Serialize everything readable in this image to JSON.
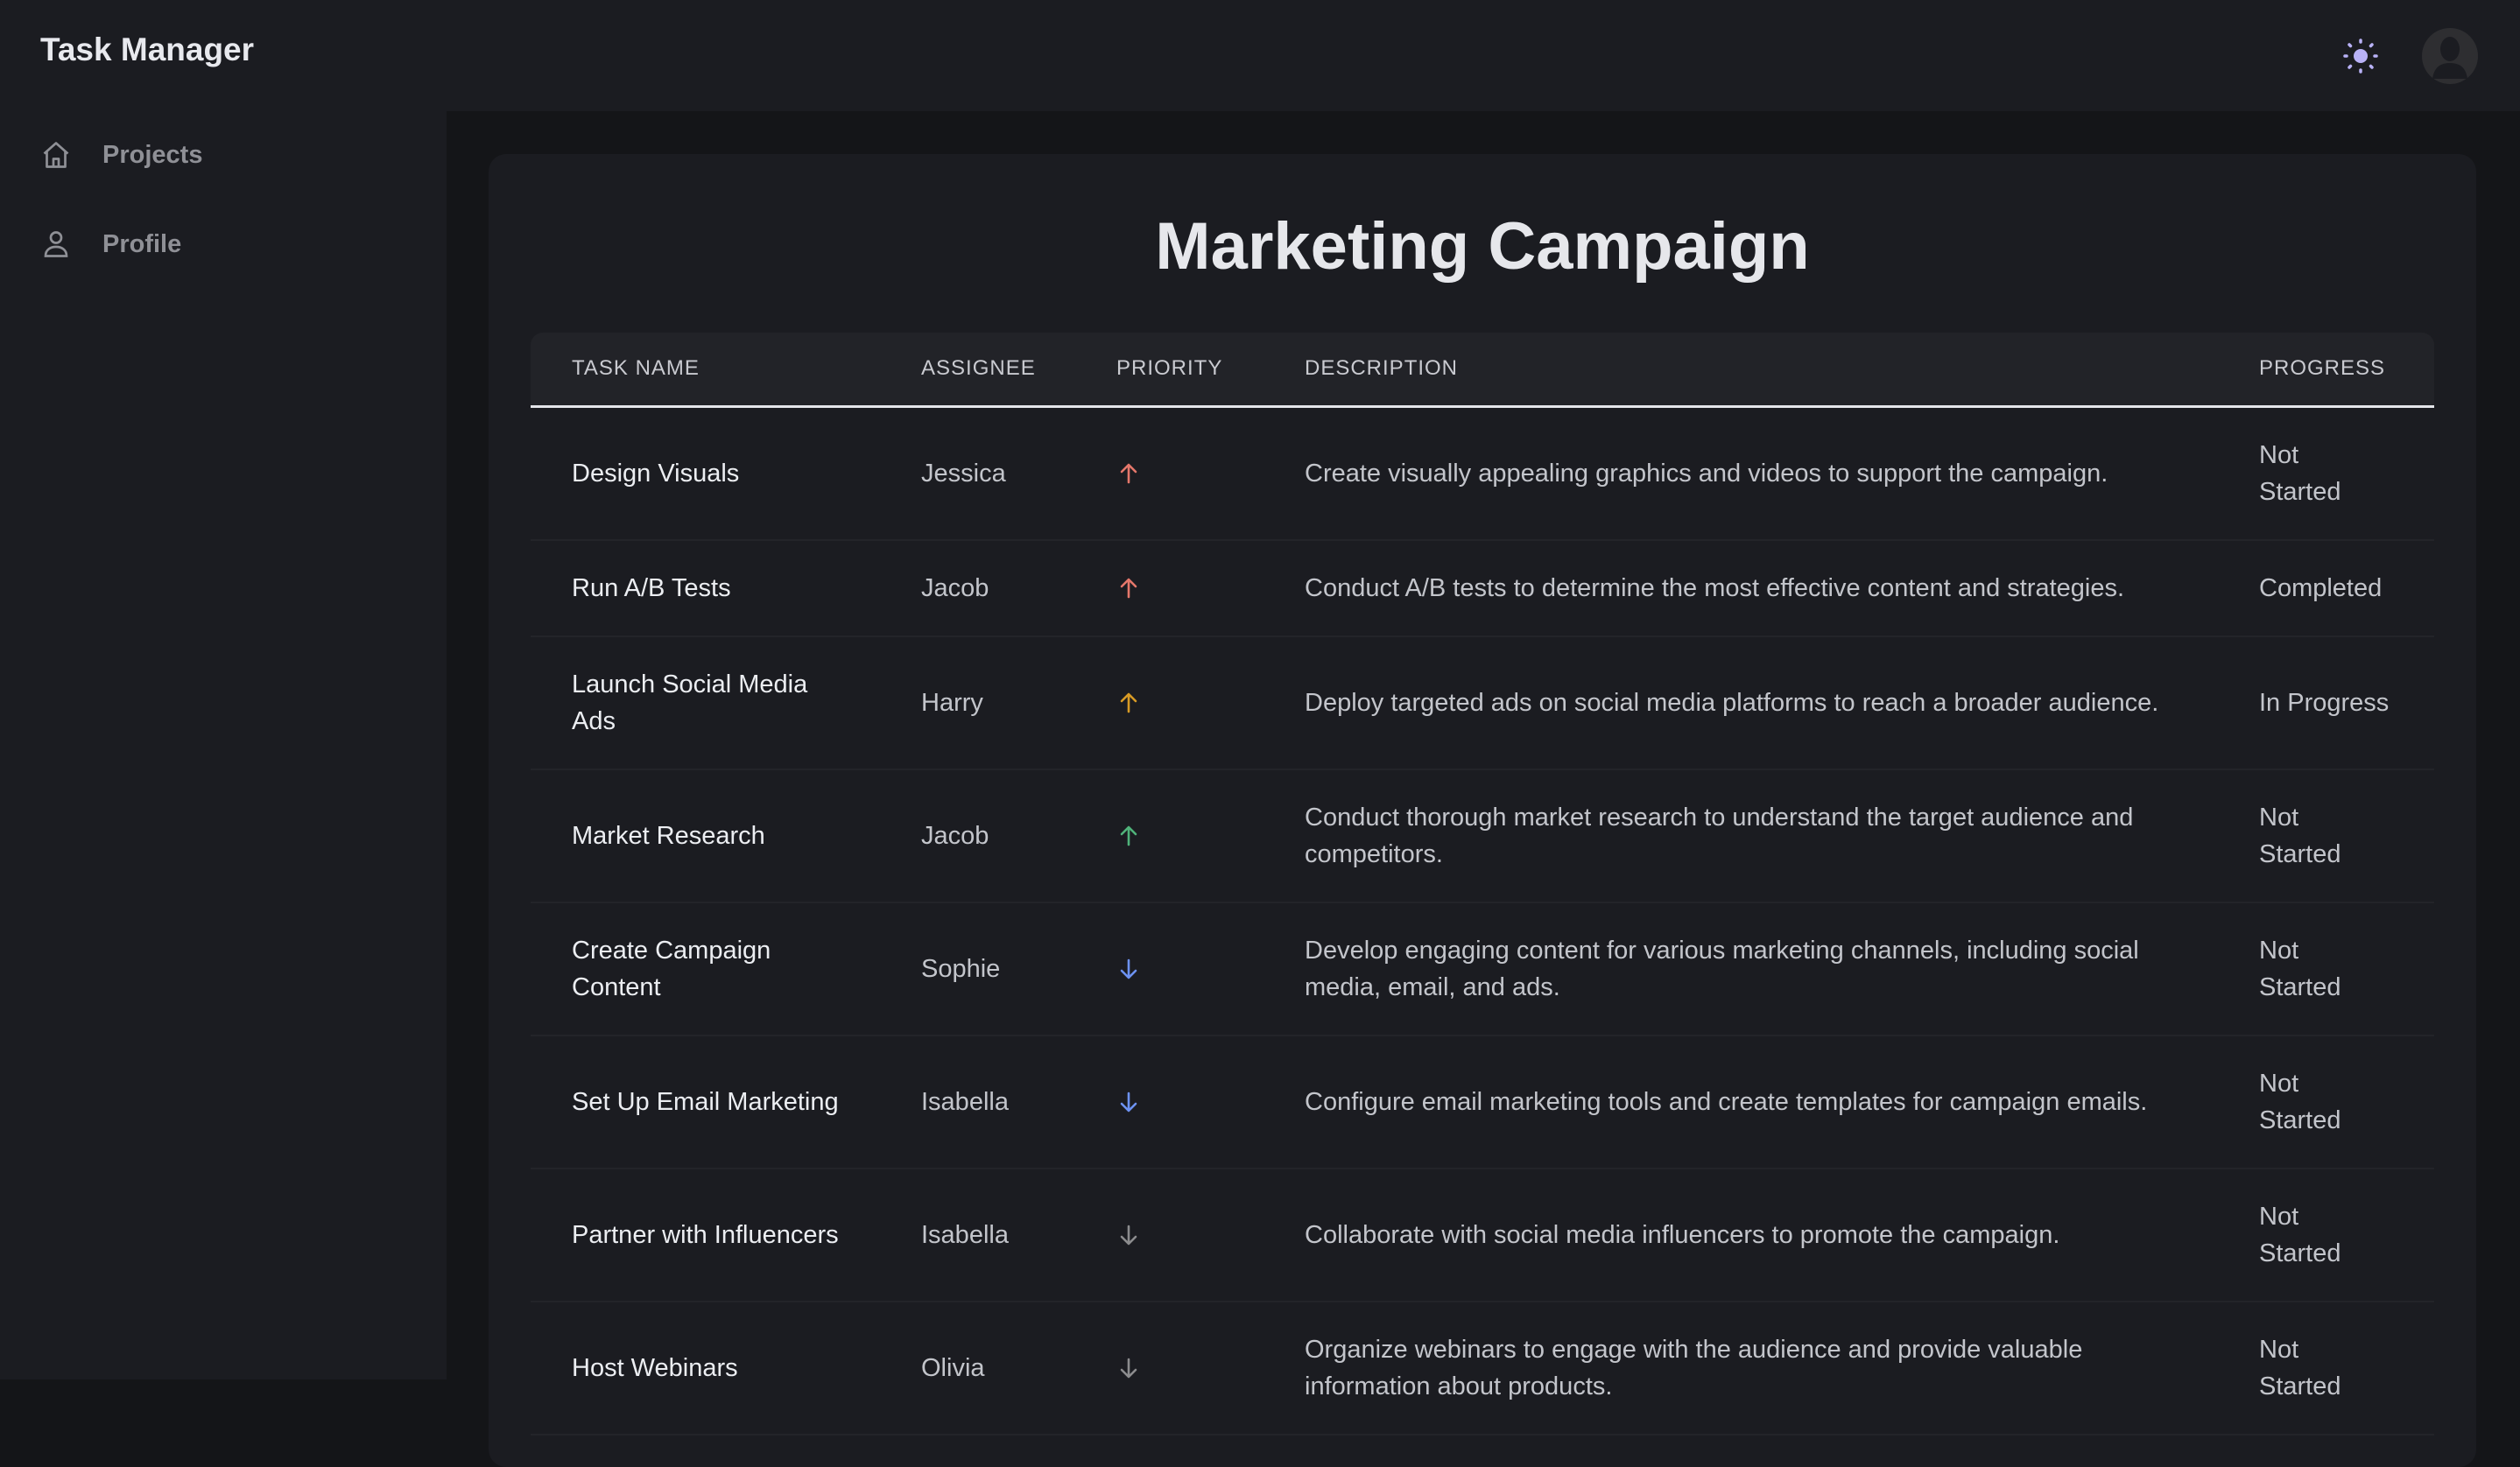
{
  "app": {
    "title": "Task Manager"
  },
  "sidebar": {
    "items": [
      {
        "label": "Projects",
        "icon": "home-icon"
      },
      {
        "label": "Profile",
        "icon": "user-icon"
      }
    ]
  },
  "header": {
    "theme_icon": "sun-icon",
    "avatar_icon": "avatar-icon"
  },
  "page": {
    "title": "Marketing Campaign"
  },
  "table": {
    "columns": [
      "Task Name",
      "Assignee",
      "Priority",
      "Description",
      "Progress"
    ],
    "rows": [
      {
        "task": "Design Visuals",
        "assignee": "Jessica",
        "priority_icon": "arrow-up-icon",
        "priority_color": "#e5776b",
        "description": "Create visually appealing graphics and videos to support the campaign.",
        "progress": "Not Started"
      },
      {
        "task": "Run A/B Tests",
        "assignee": "Jacob",
        "priority_icon": "arrow-up-icon",
        "priority_color": "#e5776b",
        "description": "Conduct A/B tests to determine the most effective content and strategies.",
        "progress": "Completed"
      },
      {
        "task": "Launch Social Media Ads",
        "assignee": "Harry",
        "priority_icon": "arrow-up-icon",
        "priority_color": "#d89b25",
        "description": "Deploy targeted ads on social media platforms to reach a broader audience.",
        "progress": "In Progress"
      },
      {
        "task": "Market Research",
        "assignee": "Jacob",
        "priority_icon": "arrow-up-icon",
        "priority_color": "#4fb37a",
        "description": "Conduct thorough market research to understand the target audience and competitors.",
        "progress": "Not Started"
      },
      {
        "task": "Create Campaign Content",
        "assignee": "Sophie",
        "priority_icon": "arrow-down-icon",
        "priority_color": "#6d92f2",
        "description": "Develop engaging content for various marketing channels, including social media, email, and ads.",
        "progress": "Not Started"
      },
      {
        "task": "Set Up Email Marketing",
        "assignee": "Isabella",
        "priority_icon": "arrow-down-icon",
        "priority_color": "#6d92f2",
        "description": "Configure email marketing tools and create templates for campaign emails.",
        "progress": "Not Started"
      },
      {
        "task": "Partner with Influencers",
        "assignee": "Isabella",
        "priority_icon": "arrow-down-icon",
        "priority_color": "#8c8c8e",
        "description": "Collaborate with social media influencers to promote the campaign.",
        "progress": "Not Started"
      },
      {
        "task": "Host Webinars",
        "assignee": "Olivia",
        "priority_icon": "arrow-down-icon",
        "priority_color": "#8c8c8e",
        "description": "Organize webinars to engage with the audience and provide valuable information about products.",
        "progress": "Not Started"
      }
    ]
  }
}
